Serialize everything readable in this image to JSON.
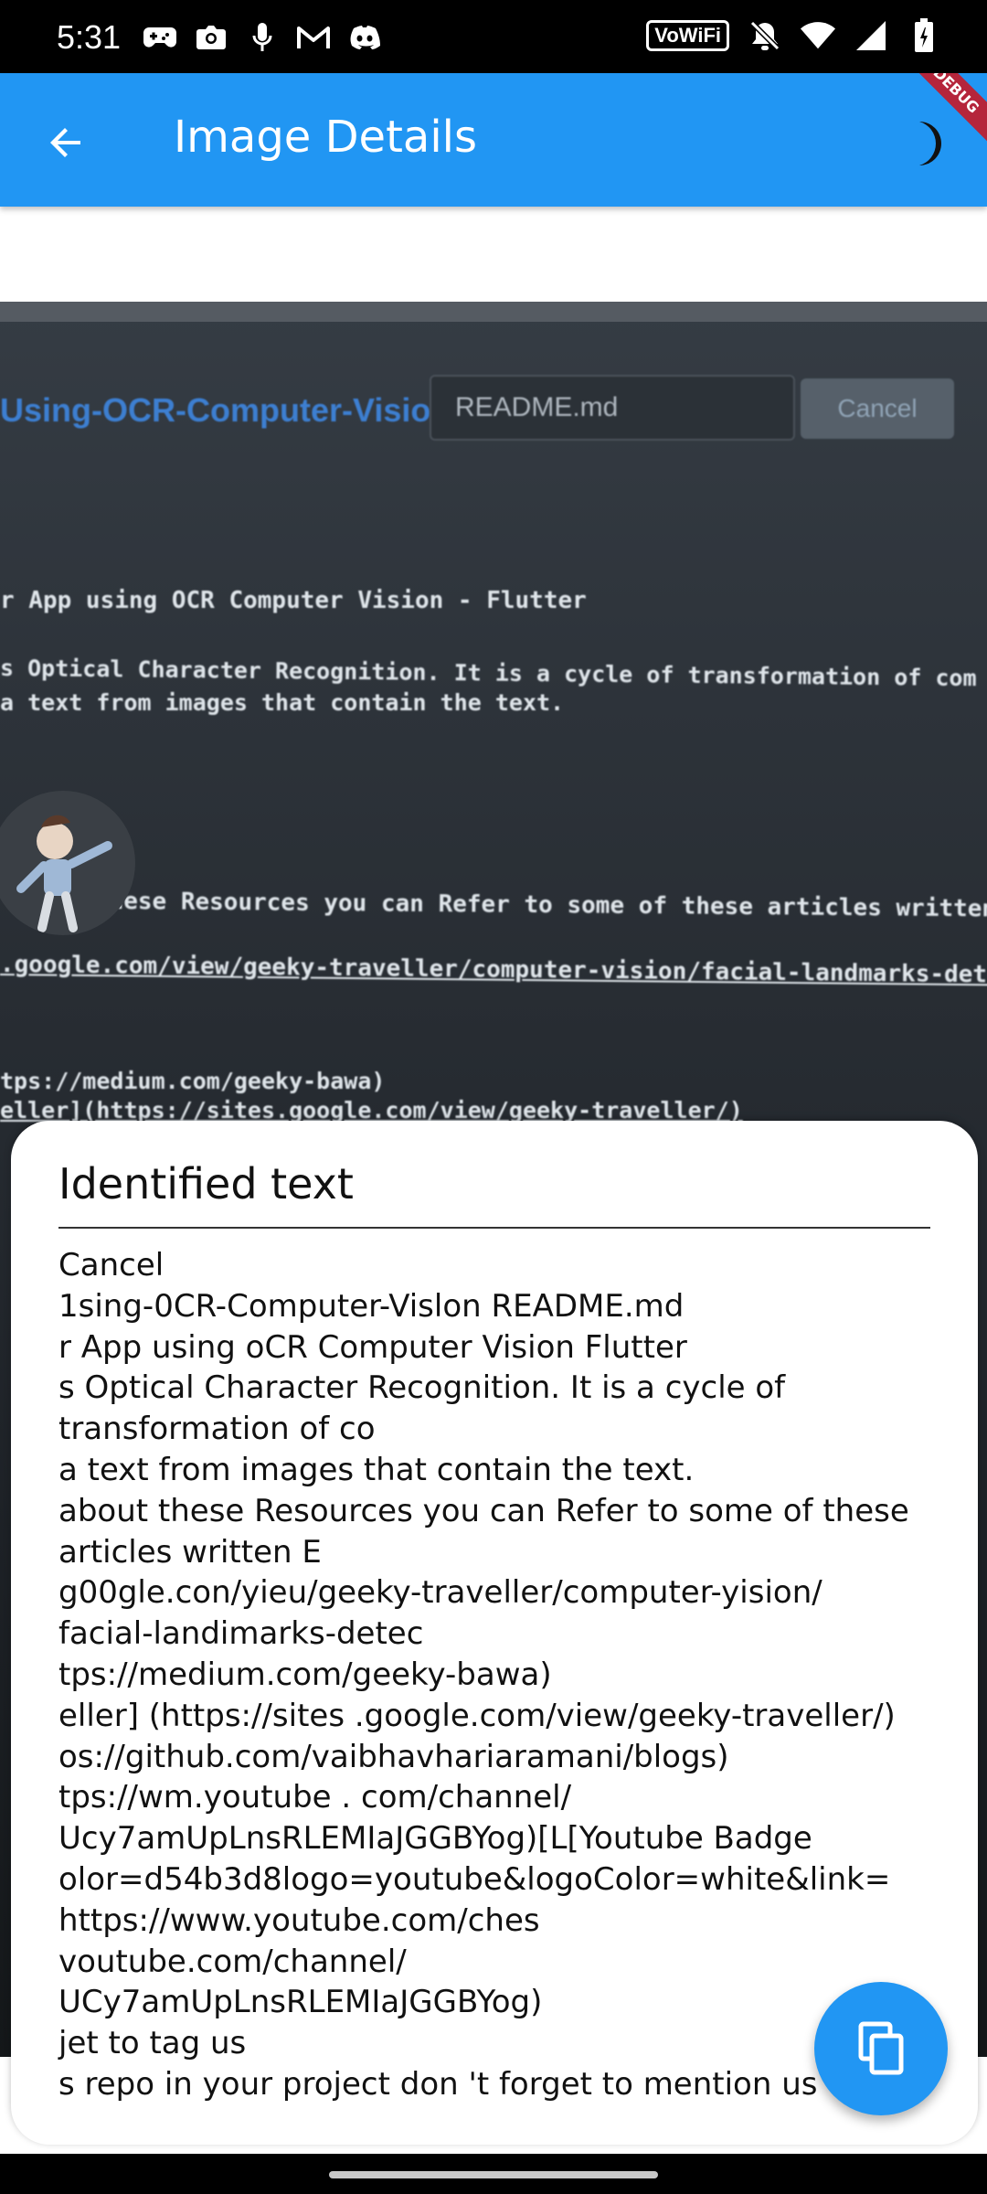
{
  "status_bar": {
    "time": "5:31",
    "left_icons": [
      "game-controller-icon",
      "camera-icon",
      "microphone-icon",
      "gmail-icon",
      "discord-icon"
    ],
    "wifi_label": "VoWiFi",
    "right_icons": [
      "do-not-disturb-icon",
      "wifi-icon",
      "signal-icon",
      "battery-icon"
    ]
  },
  "app_bar": {
    "title": "Image Details",
    "background": "#2196f3",
    "back_icon": "arrow-back-icon",
    "theme_icon": "dark-mode-moon-icon",
    "ribbon_text": "DEBUG"
  },
  "photo": {
    "repo_text": "Using-OCR-Computer-Vision",
    "field_text": "README.md",
    "cancel_text": "Cancel",
    "line1": "r App using OCR Computer Vision - Flutter",
    "line2": "s Optical Character Recognition. It is a cycle of transformation of com",
    "line3": "a text from images that contain the text.",
    "line4": "about these Resources you can Refer to some of these articles written b",
    "line5": ".google.com/view/geeky-traveller/computer-vision/facial-landmarks-detect",
    "line6": "tps://medium.com/geeky-bawa)",
    "line7": "eller](https://sites.google.com/view/geeky-traveller/)"
  },
  "sheet": {
    "title": "Identified text",
    "lines": [
      "Cancel",
      "1sing-0CR-Computer-Vislon README.md",
      "r App using oCR Computer Vision Flutter",
      "s Optical Character Recognition. It is a cycle of",
      "transformation of co",
      "a text from images that contain the text.",
      "about these Resources you can Refer to some of these",
      "articles written E",
      "g00gle.con/yieu/geeky-traveller/computer-yision/",
      "facial-landimarks-detec",
      "tps://medium.com/geeky-bawa)",
      "eller] (https://sites .google.com/view/geeky-traveller/)",
      "os://github.com/vaibhavhariaramani/blogs)",
      "tps://wm.youtube . com/channel/",
      "Ucy7amUpLnsRLEMIaJGGBYog)[L[Youtube Badge",
      "olor=d54b3d8logo=youtube&logoColor=white&link=",
      "https://www.youtube.com/ches",
      "voutube.com/channel/",
      "UCy7amUpLnsRLEMIaJGGBYog)",
      "jet to tag us",
      "s repo in your project don 't forget to mention us"
    ]
  },
  "fab": {
    "icon": "copy-icon"
  }
}
